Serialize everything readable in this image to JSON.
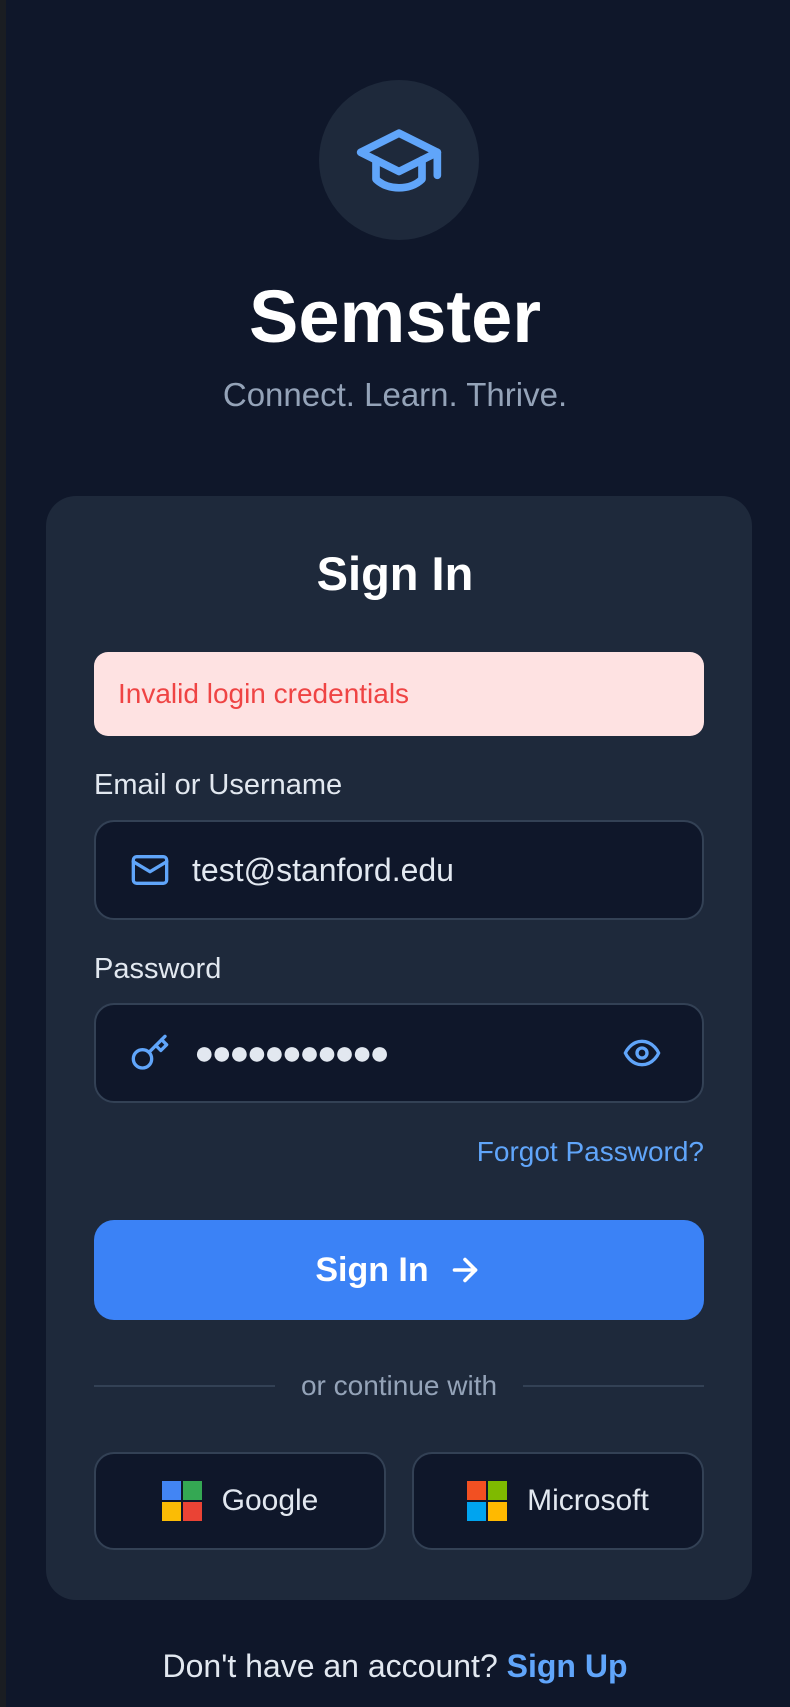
{
  "app": {
    "title": "Semster",
    "tagline": "Connect. Learn. Thrive.",
    "logo_icon": "graduation-cap-icon"
  },
  "card": {
    "title": "Sign In",
    "error_message": "Invalid login credentials",
    "email": {
      "label": "Email or Username",
      "value": "test@stanford.edu",
      "icon": "mail-icon"
    },
    "password": {
      "label": "Password",
      "masked_value": "●●●●●●●●●●●",
      "icon": "key-icon",
      "toggle_icon": "eye-icon"
    },
    "forgot_password": "Forgot Password?",
    "submit_label": "Sign In",
    "divider_text": "or continue with",
    "social": {
      "google_label": "Google",
      "microsoft_label": "Microsoft"
    }
  },
  "footer": {
    "prompt": "Don't have an account?",
    "signup_label": "Sign Up"
  },
  "colors": {
    "background": "#0f172a",
    "card": "#1e293b",
    "accent": "#3b82f6",
    "link": "#60a5fa",
    "error_bg": "#fee2e2",
    "error_text": "#ef4444"
  }
}
